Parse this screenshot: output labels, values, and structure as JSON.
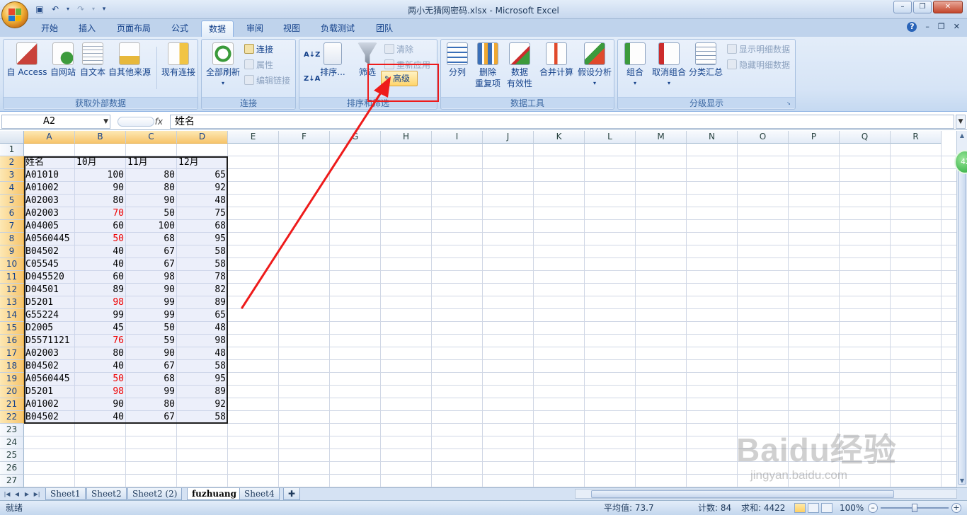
{
  "window": {
    "title": "两小无猜网密码.xlsx - Microsoft Excel",
    "help": "?",
    "minimize": "–",
    "restore": "❐",
    "close": "✕"
  },
  "ribbon_tabs": [
    "开始",
    "插入",
    "页面布局",
    "公式",
    "数据",
    "审阅",
    "视图",
    "负载测试",
    "团队"
  ],
  "ribbon": {
    "external_data": {
      "label": "获取外部数据",
      "from_access": "自 Access",
      "from_web": "自网站",
      "from_text": "自文本",
      "from_other": "自其他来源",
      "existing": "现有连接"
    },
    "connections": {
      "label": "连接",
      "refresh_all": "全部刷新",
      "connections": "连接",
      "properties": "属性",
      "edit_links": "编辑链接"
    },
    "sort_filter": {
      "label": "排序和筛选",
      "sort_az": "A↓Z",
      "sort_za": "Z↓A",
      "sort": "排序...",
      "filter": "筛选",
      "clear": "清除",
      "reapply": "重新应用",
      "advanced": "高级"
    },
    "data_tools": {
      "label": "数据工具",
      "text_to_columns": "分列",
      "remove_dup_line1": "删除",
      "remove_dup_line2": "重复项",
      "validation_line1": "数据",
      "validation_line2": "有效性",
      "consolidate": "合并计算",
      "what_if": "假设分析"
    },
    "outline": {
      "label": "分级显示",
      "group": "组合",
      "ungroup": "取消组合",
      "subtotal": "分类汇总",
      "show_detail": "显示明细数据",
      "hide_detail": "隐藏明细数据"
    }
  },
  "formula_bar": {
    "name_box": "A2",
    "fx": "fx",
    "value": "姓名"
  },
  "columns": [
    "A",
    "B",
    "C",
    "D",
    "E",
    "F",
    "G",
    "H",
    "I",
    "J",
    "K",
    "L",
    "M",
    "N",
    "O",
    "P",
    "Q",
    "R"
  ],
  "rows": [
    "1",
    "2",
    "3",
    "4",
    "5",
    "6",
    "7",
    "8",
    "9",
    "10",
    "11",
    "12",
    "13",
    "14",
    "15",
    "16",
    "17",
    "18",
    "19",
    "20",
    "21",
    "22",
    "23",
    "24",
    "25",
    "26",
    "27"
  ],
  "sheet": {
    "headers": [
      "姓名",
      "10月",
      "11月",
      "12月"
    ],
    "data": [
      [
        "A01010",
        100,
        80,
        65
      ],
      [
        "A01002",
        90,
        80,
        92
      ],
      [
        "A02003",
        80,
        90,
        48
      ],
      [
        "A02003",
        70,
        50,
        75
      ],
      [
        "A04005",
        60,
        100,
        68
      ],
      [
        "A0560445",
        50,
        68,
        95
      ],
      [
        "B04502",
        40,
        67,
        58
      ],
      [
        "C05545",
        40,
        67,
        58
      ],
      [
        "D045520",
        60,
        98,
        78
      ],
      [
        "D04501",
        89,
        90,
        82
      ],
      [
        "D5201",
        98,
        99,
        89
      ],
      [
        "G55224",
        99,
        99,
        65
      ],
      [
        "D2005",
        45,
        50,
        48
      ],
      [
        "D5571121",
        76,
        59,
        98
      ],
      [
        "A02003",
        80,
        90,
        48
      ],
      [
        "B04502",
        40,
        67,
        58
      ],
      [
        "A0560445",
        50,
        68,
        95
      ],
      [
        "D5201",
        98,
        99,
        89
      ],
      [
        "A01002",
        90,
        80,
        92
      ],
      [
        "B04502",
        40,
        67,
        58
      ]
    ],
    "red_cells_col_b": [
      3,
      5,
      10,
      13,
      16,
      17
    ]
  },
  "sheet_tabs": [
    "Sheet1",
    "Sheet2",
    "Sheet2 (2)",
    "fuzhuang",
    "Sheet4"
  ],
  "active_sheet": "fuzhuang",
  "status": {
    "mode": "就绪",
    "average": "平均值: 73.7",
    "count": "计数: 84",
    "sum": "求和: 4422",
    "zoom": "100%"
  },
  "badge": "42",
  "watermark": {
    "main": "Baidu经验",
    "sub": "jingyan.baidu.com"
  },
  "colors": {
    "accent": "#15428b",
    "annotation": "#ee1b1b",
    "highlight_value": "#e00000"
  }
}
